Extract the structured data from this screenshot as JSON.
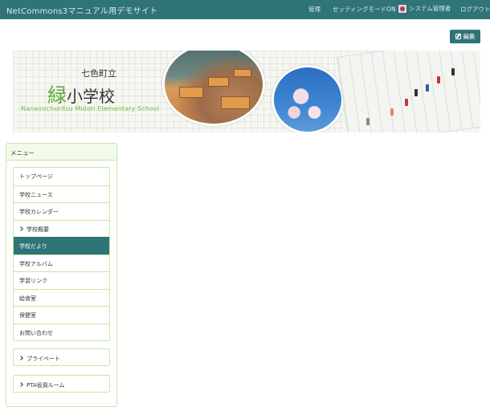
{
  "navbar": {
    "brand": "NetCommons3マニュアル用デモサイト",
    "admin": "管理",
    "setting_mode": "セッティングモードON",
    "user": "システム管理者",
    "logout": "ログアウト"
  },
  "edit_button": {
    "label": "編集"
  },
  "banner": {
    "town": "七色町立",
    "school_accent": "緑",
    "school_rest": "小学校",
    "english": "Nanairochoritsu Midori Elementary School"
  },
  "menu": {
    "heading": "メニュー",
    "items": [
      {
        "label": "トップページ"
      },
      {
        "label": "学校ニュース"
      },
      {
        "label": "学校カレンダー"
      },
      {
        "label": "学校概要"
      },
      {
        "label": "学校だより"
      },
      {
        "label": "学校アルバム"
      },
      {
        "label": "学習リンク"
      },
      {
        "label": "給食室"
      },
      {
        "label": "保健室"
      },
      {
        "label": "お問い合わせ"
      }
    ],
    "private": "プライベート",
    "pta": "PTA役員ルーム"
  },
  "colors": {
    "navbar": "#2f7476",
    "active_item": "#2f7476",
    "menu_border": "#c6e6a8",
    "school_accent": "#5aa63a"
  }
}
